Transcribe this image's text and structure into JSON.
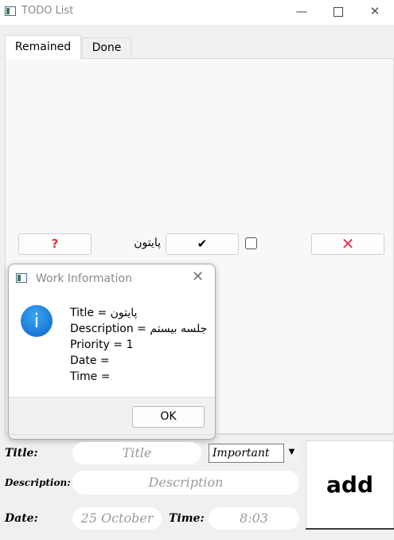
{
  "window": {
    "title": "TODO List",
    "controls": {
      "minimize": "—",
      "maximize": "",
      "close": "✕"
    }
  },
  "tabs": [
    {
      "label": "Remained",
      "selected": true
    },
    {
      "label": "Done",
      "selected": false
    }
  ],
  "todo_item": {
    "info_label": "?",
    "title": "پایتون",
    "done_label": "✔",
    "checked": false,
    "delete_label": "✕"
  },
  "dialog": {
    "title": "Work Information",
    "close": "✕",
    "icon": "i",
    "lines": [
      "Title = پایتون",
      "Description = جلسه بیستم",
      "Priority = 1",
      "Date =",
      "Time ="
    ],
    "ok_label": "OK"
  },
  "form": {
    "title_label": "Title:",
    "title_placeholder": "Title",
    "priority_value": "Important",
    "priority_arrow": "▼",
    "description_label": "Description:",
    "description_placeholder": "Description",
    "date_label": "Date:",
    "date_value": "25 October",
    "time_label": "Time:",
    "time_value": "8:03",
    "add_label": "add"
  },
  "colors": {
    "info_icon": "#e0353a",
    "delete_icon": "#e3355a",
    "dialog_info_icon": "#1a7fe0"
  }
}
